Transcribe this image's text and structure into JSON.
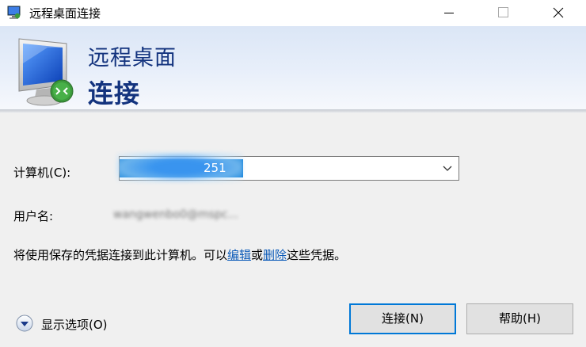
{
  "window": {
    "title": "远程桌面连接"
  },
  "banner": {
    "line1": "远程桌面",
    "line2": "连接"
  },
  "form": {
    "computer_label": "计算机(C):",
    "computer_value": "251",
    "user_label": "用户名:",
    "user_value": "wangwenbo0@mspc..."
  },
  "info": {
    "prefix": "将使用保存的凭据连接到此计算机。可以",
    "edit_link": "编辑",
    "middle": "或",
    "delete_link": "删除",
    "suffix": "这些凭据。"
  },
  "options": {
    "label": "显示选项(O)"
  },
  "buttons": {
    "connect": "连接(N)",
    "help": "帮助(H)"
  },
  "colors": {
    "accent": "#0078d7",
    "banner_text": "#13337e",
    "link": "#0b5ab8"
  }
}
